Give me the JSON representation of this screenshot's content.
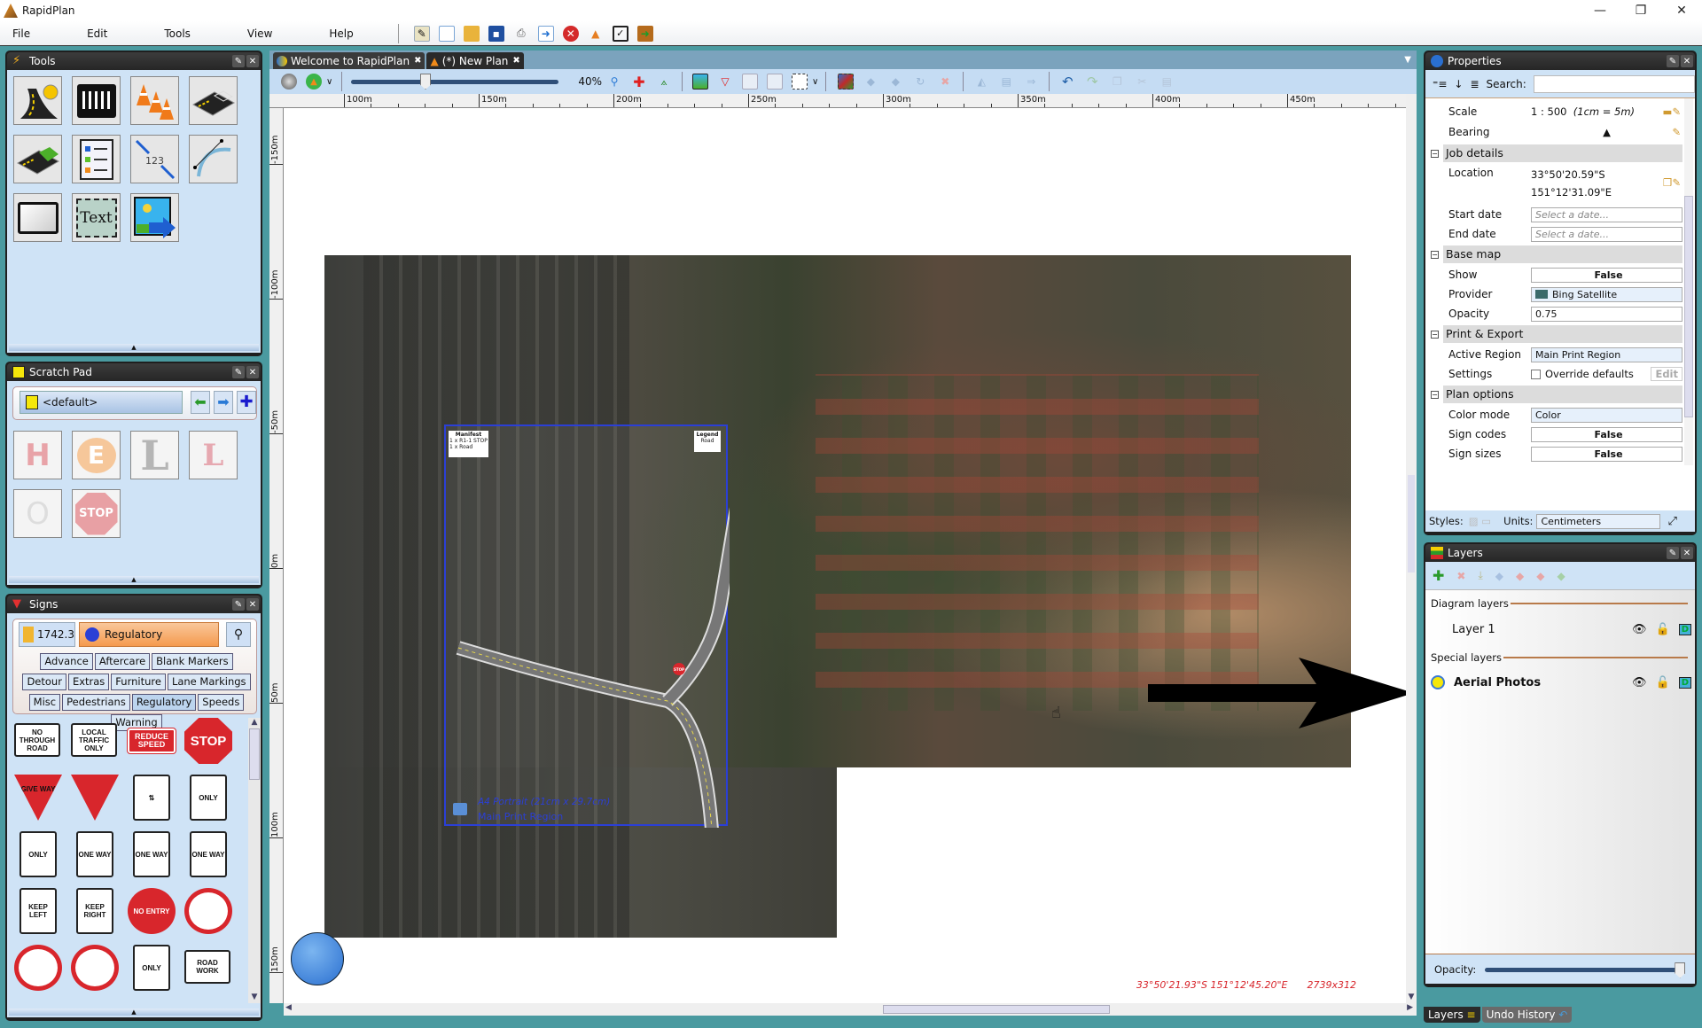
{
  "app": {
    "title": "RapidPlan",
    "window_controls": [
      "minimize",
      "restore",
      "close"
    ]
  },
  "menu": [
    "File",
    "Edit",
    "Tools",
    "View",
    "Help"
  ],
  "toolbar_icons": [
    "new-plan-wizard-icon",
    "new-document-icon",
    "open-folder-icon",
    "save-icon",
    "print-icon",
    "export-icon",
    "close-red-icon",
    "cone-icon",
    "checkbox-icon",
    "exit-door-icon"
  ],
  "tools_panel": {
    "title": "Tools",
    "tools": [
      "quick-road-tool",
      "pedestrian-crossing-tool",
      "traffic-cones-tool",
      "road-area-tool",
      "hatched-area-tool",
      "legend-tool",
      "dimension-tool",
      "curve-tool",
      "rectangle-tool",
      "text-tool",
      "insert-image-tool"
    ],
    "text_tool_label": "Text",
    "dimension_label": "123"
  },
  "scratch_pad": {
    "title": "Scratch Pad",
    "selected": "<default>",
    "items": [
      "H",
      "E",
      "L",
      "L",
      "O",
      "STOP"
    ]
  },
  "signs_panel": {
    "title": "Signs",
    "standard": "1742.3",
    "category": "Regulatory",
    "categories": [
      [
        "Advance",
        "Aftercare",
        "Blank Markers",
        "Detour"
      ],
      [
        "Extras",
        "Furniture",
        "Lane Markings",
        "Misc"
      ],
      [
        "Pedestrians",
        "Regulatory",
        "Speeds",
        "Warning"
      ]
    ],
    "signs": [
      {
        "name": "no-through-road",
        "text": "NO THROUGH ROAD"
      },
      {
        "name": "local-traffic-only",
        "text": "LOCAL TRAFFIC ONLY"
      },
      {
        "name": "reduce-speed",
        "text": "REDUCE SPEED"
      },
      {
        "name": "stop",
        "text": "STOP"
      },
      {
        "name": "give-way",
        "text": "GIVE WAY"
      },
      {
        "name": "roundabout",
        "text": ""
      },
      {
        "name": "two-way",
        "text": "⇅"
      },
      {
        "name": "left-only",
        "text": "ONLY"
      },
      {
        "name": "right-only",
        "text": "ONLY"
      },
      {
        "name": "one-way-up",
        "text": "ONE WAY"
      },
      {
        "name": "one-way-left",
        "text": "ONE WAY"
      },
      {
        "name": "one-way-right",
        "text": "ONE WAY"
      },
      {
        "name": "keep-left",
        "text": "KEEP LEFT"
      },
      {
        "name": "keep-right",
        "text": "KEEP RIGHT"
      },
      {
        "name": "no-entry",
        "text": "NO ENTRY"
      },
      {
        "name": "no-u-turn",
        "text": ""
      },
      {
        "name": "no-left-turn",
        "text": ""
      },
      {
        "name": "no-right-turn",
        "text": ""
      },
      {
        "name": "straight-only",
        "text": "ONLY"
      },
      {
        "name": "road-work",
        "text": "ROAD WORK"
      }
    ]
  },
  "tabs": [
    {
      "label": "Welcome to RapidPlan",
      "active": false
    },
    {
      "label": "(*) New Plan",
      "active": true
    }
  ],
  "plan_toolbar": {
    "zoom": "40%",
    "zoom_fraction": 0.35
  },
  "ruler": {
    "h_labels": [
      "100m",
      "150m",
      "200m",
      "250m",
      "300m",
      "350m",
      "400m",
      "450m"
    ],
    "v_labels": [
      "-150m",
      "-100m",
      "-50m",
      "0m",
      "50m",
      "100m",
      "150m"
    ]
  },
  "canvas": {
    "manifest_title": "Manifest",
    "manifest_items": [
      "1 x  R1-1 STOP",
      "1 x  Road"
    ],
    "legend_title": "Legend",
    "legend_items": [
      "Road"
    ],
    "print_region_size": "A4 Portrait (21cm x 29.7cm)",
    "print_region_name": "Main Print Region",
    "stop_sign": "STOP"
  },
  "status": {
    "coords": "33°50'21.93\"S 151°12'45.20\"E",
    "size": "2739x312"
  },
  "properties": {
    "title": "Properties",
    "search_label": "Search:",
    "search_value": "",
    "scale_label": "Scale",
    "scale_value": "1 : 500",
    "scale_note": "(1cm = 5m)",
    "bearing_label": "Bearing",
    "job_details": "Job details",
    "location_label": "Location",
    "location_lat": "33°50'20.59\"S",
    "location_lon": "151°12'31.09\"E",
    "start_date_label": "Start date",
    "end_date_label": "End date",
    "date_placeholder": "Select a date...",
    "base_map": "Base map",
    "show_label": "Show",
    "show_value": "False",
    "provider_label": "Provider",
    "provider_value": "Bing Satellite",
    "opacity_label": "Opacity",
    "opacity_value": "0.75",
    "print_export": "Print & Export",
    "active_region_label": "Active Region",
    "active_region_value": "Main Print Region",
    "settings_label": "Settings",
    "override_label": "Override defaults",
    "override_checked": false,
    "edit_label": "Edit",
    "plan_options": "Plan options",
    "color_mode_label": "Color mode",
    "color_mode_value": "Color",
    "sign_codes_label": "Sign codes",
    "sign_codes_value": "False",
    "sign_sizes_label": "Sign sizes",
    "sign_sizes_value": "False",
    "styles_label": "Styles:",
    "units_label": "Units:",
    "units_value": "Centimeters"
  },
  "layers": {
    "title": "Layers",
    "diagram_layers": "Diagram layers",
    "layer1": "Layer 1",
    "special_layers": "Special layers",
    "aerial": "Aerial Photos",
    "opacity_label": "Opacity:",
    "opacity_fraction": 1.0
  },
  "bottom_tabs": [
    "Layers",
    "Undo History"
  ],
  "colors": {
    "accent_orange": "#f6a25a",
    "region_blue": "#2b3fd6",
    "status_red": "#d8262c",
    "panel_bg": "#cfe3f6",
    "header_dark": "#262626"
  }
}
